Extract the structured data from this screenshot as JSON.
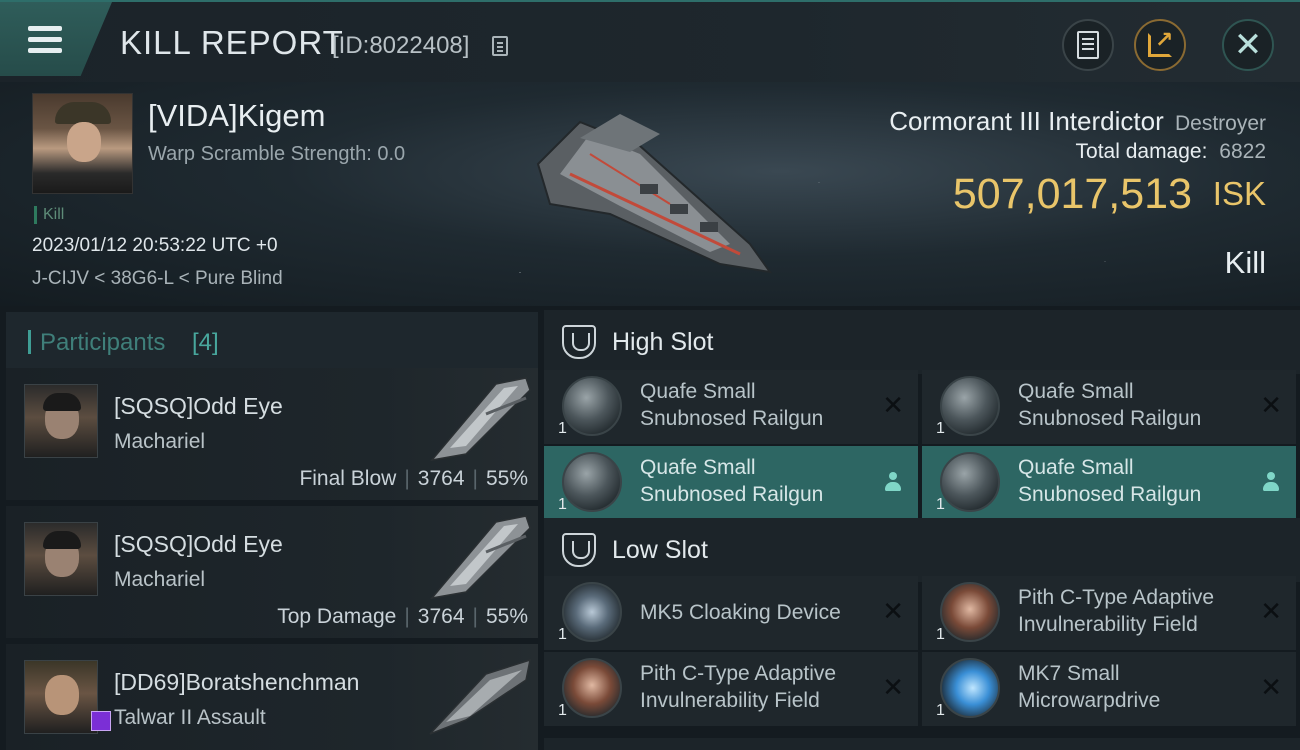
{
  "header": {
    "title": "KILL REPORT",
    "report_id": "[ID:8022408]"
  },
  "victim": {
    "name": "[VIDA]Kigem",
    "warp_scramble": "Warp Scramble Strength: 0.0",
    "tag": "Kill",
    "timestamp": "2023/01/12 20:53:22 UTC +0",
    "location": "J-CIJV < 38G6-L < Pure Blind",
    "ship_name": "Cormorant III Interdictor",
    "ship_class": "Destroyer",
    "total_damage_label": "Total damage:",
    "total_damage": "6822",
    "isk_value": "507,017,513",
    "isk_unit": "ISK",
    "result": "Kill"
  },
  "participants": {
    "title": "Participants",
    "count": "[4]",
    "items": [
      {
        "name": "[SQSQ]Odd Eye",
        "ship": "Machariel",
        "role": "Final Blow",
        "damage": "3764",
        "percent": "55%"
      },
      {
        "name": "[SQSQ]Odd Eye",
        "ship": "Machariel",
        "role": "Top Damage",
        "damage": "3764",
        "percent": "55%"
      },
      {
        "name": "[DD69]Boratshenchman",
        "ship": "Talwar II Assault"
      }
    ]
  },
  "fittings": {
    "high_slot": {
      "title": "High Slot",
      "modules": [
        {
          "line1": "Quafe Small",
          "line2": "Snubnosed Railgun",
          "qty": "1",
          "state": "destroyed"
        },
        {
          "line1": "Quafe Small",
          "line2": "Snubnosed Railgun",
          "qty": "1",
          "state": "destroyed"
        },
        {
          "line1": "Quafe Small",
          "line2": "Snubnosed Railgun",
          "qty": "1",
          "state": "dropped"
        },
        {
          "line1": "Quafe Small",
          "line2": "Snubnosed Railgun",
          "qty": "1",
          "state": "dropped"
        }
      ]
    },
    "low_slot": {
      "title": "Low Slot",
      "modules": [
        {
          "line1": "MK5 Cloaking Device",
          "qty": "1",
          "state": "destroyed",
          "icon": "cloaking-device-icon"
        },
        {
          "line1": "Pith C-Type Adaptive",
          "line2": "Invulnerability Field",
          "qty": "1",
          "state": "destroyed",
          "icon": "invulnerability-field-icon"
        },
        {
          "line1": "Pith C-Type Adaptive",
          "line2": "Invulnerability Field",
          "qty": "1",
          "state": "destroyed",
          "icon": "invulnerability-field-icon"
        },
        {
          "line1": "MK7 Small",
          "line2": "Microwarpdrive",
          "qty": "1",
          "state": "destroyed",
          "icon": "microwarpdrive-icon"
        }
      ]
    }
  },
  "colors": {
    "accent_teal": "#2d6663",
    "isk_gold": "#e9c56a",
    "victim_badge_red": "#b81a1a",
    "participant_badge_purple": "#7b2fd6"
  }
}
